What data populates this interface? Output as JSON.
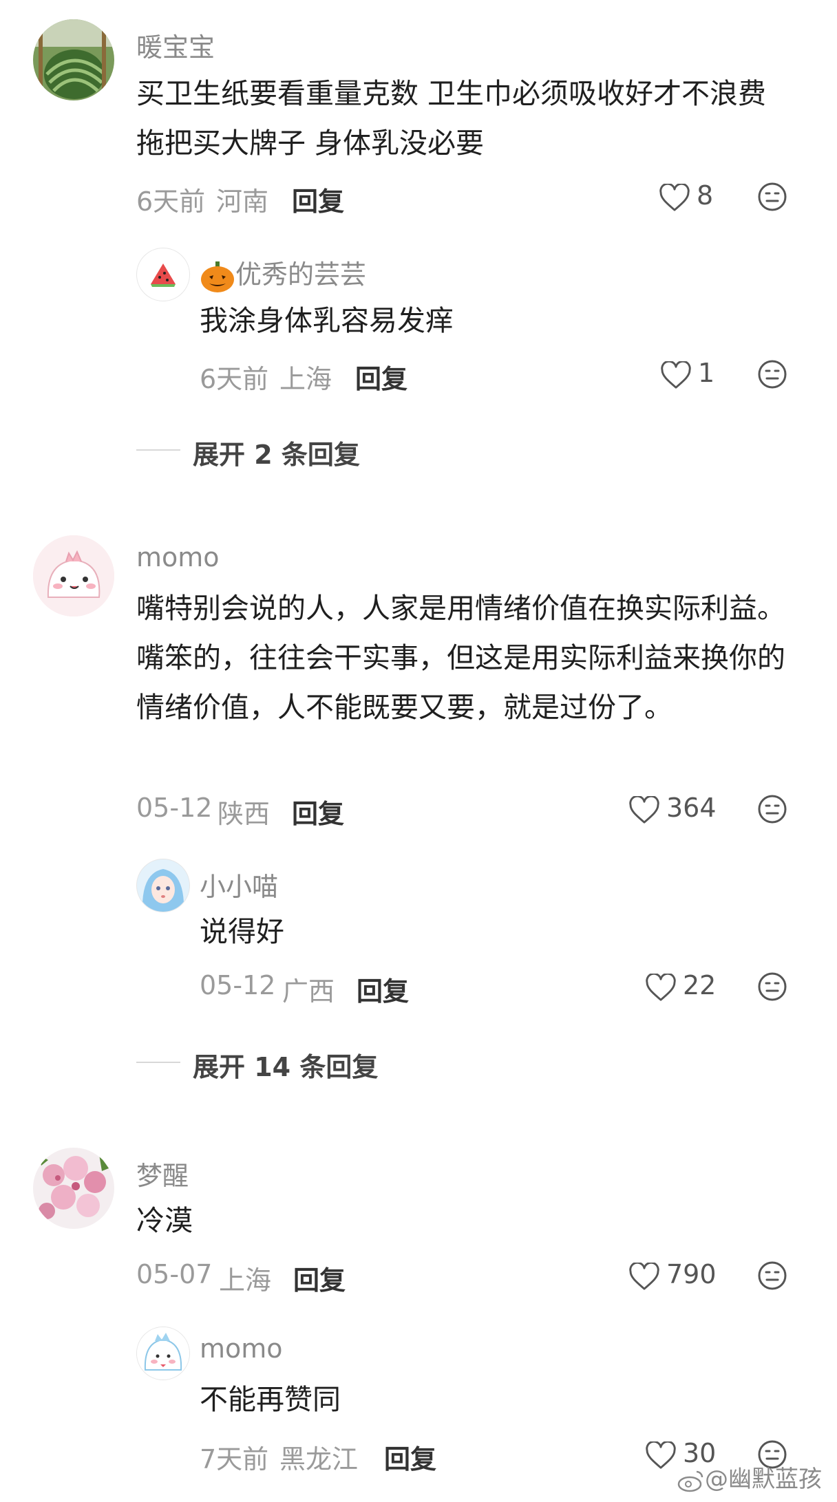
{
  "comments": [
    {
      "username": "暖宝宝",
      "text": "买卫生纸要看重量克数 卫生巾必须吸收好才不浪费 拖把买大牌子 身体乳没必要",
      "time": "6天前",
      "location": "河南",
      "reply_label": "回复",
      "likes": "8",
      "replies": [
        {
          "username": "优秀的芸芸",
          "text": "我涂身体乳容易发痒",
          "time": "6天前",
          "location": "上海",
          "reply_label": "回复",
          "likes": "1"
        }
      ],
      "expand_label": "展开 2 条回复"
    },
    {
      "username": "momo",
      "text": "嘴特别会说的人，人家是用情绪价值在换实际利益。嘴笨的，往往会干实事，但这是用实际利益来换你的情绪价值，人不能既要又要，就是过份了。",
      "time": "05-12",
      "location": "陕西",
      "reply_label": "回复",
      "likes": "364",
      "replies": [
        {
          "username": "小小喵",
          "text": "说得好",
          "time": "05-12",
          "location": "广西",
          "reply_label": "回复",
          "likes": "22"
        }
      ],
      "expand_label": "展开 14 条回复"
    },
    {
      "username": "梦醒",
      "text": "冷漠",
      "time": "05-07",
      "location": "上海",
      "reply_label": "回复",
      "likes": "790",
      "replies": [
        {
          "username": "momo",
          "text": "不能再赞同",
          "time": "7天前",
          "location": "黑龙江",
          "reply_label": "回复",
          "likes": "30"
        }
      ]
    }
  ],
  "watermark": "@幽默蓝孩",
  "icons": {
    "like": "heart-outline-icon",
    "react": "emoji-face-icon",
    "pumpkin": "pumpkin-emoji-icon"
  },
  "colors": {
    "username": "#8a8a8a",
    "meta": "#9a9a9a",
    "text": "#1f1f1f"
  }
}
